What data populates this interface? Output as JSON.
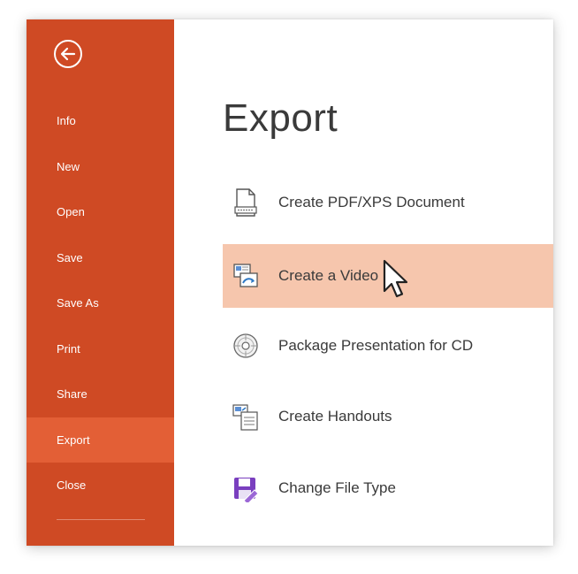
{
  "sidebar": {
    "items": [
      {
        "label": "Info"
      },
      {
        "label": "New"
      },
      {
        "label": "Open"
      },
      {
        "label": "Save"
      },
      {
        "label": "Save As"
      },
      {
        "label": "Print"
      },
      {
        "label": "Share"
      },
      {
        "label": "Export"
      },
      {
        "label": "Close"
      }
    ],
    "active": "Export",
    "icons": {
      "back": "back-arrow-circle-icon"
    }
  },
  "main": {
    "title": "Export",
    "options": [
      {
        "label": "Create PDF/XPS Document",
        "icon": "pdf-document-icon"
      },
      {
        "label": "Create a Video",
        "icon": "video-slides-icon"
      },
      {
        "label": "Package Presentation for CD",
        "icon": "cd-disc-icon"
      },
      {
        "label": "Create Handouts",
        "icon": "handouts-icon"
      },
      {
        "label": "Change File Type",
        "icon": "file-type-save-icon"
      }
    ],
    "highlighted": "Create a Video"
  },
  "colors": {
    "sidebar": "#cf4a24",
    "sidebar_active": "#e35f36",
    "highlight": "#f6c6ad",
    "text": "#3a3a3a"
  }
}
